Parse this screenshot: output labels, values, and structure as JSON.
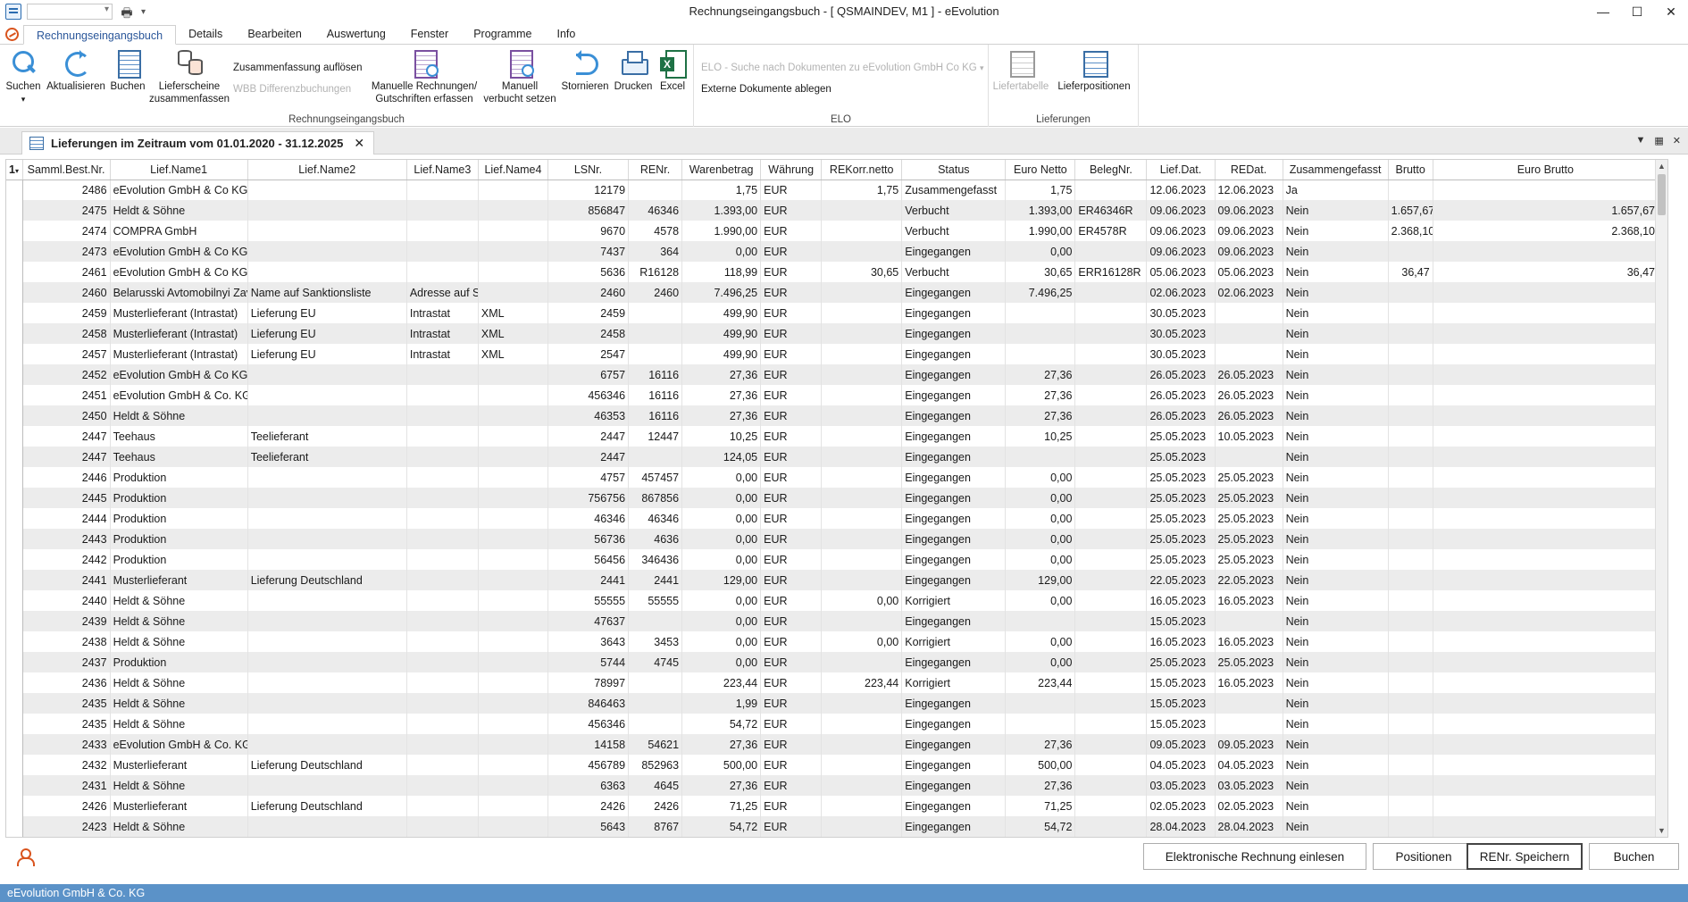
{
  "window": {
    "title": "Rechnungseingangsbuch - [ QSMAINDEV, M1 ]  -  eEvolution",
    "controls": [
      "—",
      "☐",
      "✕"
    ]
  },
  "ribbon_tabs": [
    "Rechnungseingangsbuch",
    "Details",
    "Bearbeiten",
    "Auswertung",
    "Fenster",
    "Programme",
    "Info"
  ],
  "ribbon": {
    "suchen": "Suchen",
    "aktualisieren": "Aktualisieren",
    "buchen": "Buchen",
    "lieferscheine_1": "Lieferscheine",
    "lieferscheine_2": "zusammenfassen",
    "zusammenfassung": "Zusammenfassung  auflösen",
    "wbb": "WBB Differenzbuchungen",
    "manuelle_1": "Manuelle Rechnungen/",
    "manuelle_2": "Gutschriften erfassen",
    "manuell_1": "Manuell",
    "manuell_2": "verbucht setzen",
    "stornieren": "Stornieren",
    "drucken": "Drucken",
    "excel": "Excel",
    "group_reb": "Rechnungseingangsbuch",
    "elo_search": "ELO - Suche nach Dokumenten zu eEvolution GmbH  Co KG",
    "elo_extern": "Externe Dokumente ablegen",
    "group_elo": "ELO",
    "liefertabelle": "Liefertabelle",
    "lieferpositionen": "Lieferpositionen",
    "group_lief": "Lieferungen"
  },
  "doc_tab": {
    "label": "Lieferungen im Zeitraum vom 01.01.2020 - 31.12.2025",
    "close": "✕"
  },
  "grid": {
    "selector_header": "1",
    "columns": [
      "Samml.Best.Nr.",
      "Lief.Name1",
      "Lief.Name2",
      "Lief.Name3",
      "Lief.Name4",
      "LSNr.",
      "RENr.",
      "Warenbetrag",
      "Währung",
      "REKorr.netto",
      "Status",
      "Euro Netto",
      "BelegNr.",
      "Lief.Dat.",
      "REDat.",
      "Zusammengefasst",
      "Brutto",
      "Euro Brutto"
    ],
    "rows": [
      [
        "2486",
        "eEvolution GmbH & Co KG",
        "",
        "",
        "",
        "12179",
        "",
        "1,75",
        "EUR",
        "1,75",
        "Zusammengefasst",
        "1,75",
        "",
        "12.06.2023",
        "12.06.2023",
        "Ja",
        "",
        ""
      ],
      [
        "2475",
        "Heldt & Söhne",
        "",
        "",
        "",
        "856847",
        "46346",
        "1.393,00",
        "EUR",
        "",
        "Verbucht",
        "1.393,00",
        "ER46346R",
        "09.06.2023",
        "09.06.2023",
        "Nein",
        "1.657,67",
        "1.657,67"
      ],
      [
        "2474",
        "COMPRA GmbH",
        "",
        "",
        "",
        "9670",
        "4578",
        "1.990,00",
        "EUR",
        "",
        "Verbucht",
        "1.990,00",
        "ER4578R",
        "09.06.2023",
        "09.06.2023",
        "Nein",
        "2.368,10",
        "2.368,10"
      ],
      [
        "2473",
        "eEvolution GmbH & Co KG",
        "",
        "",
        "",
        "7437",
        "364",
        "0,00",
        "EUR",
        "",
        "Eingegangen",
        "0,00",
        "",
        "09.06.2023",
        "09.06.2023",
        "Nein",
        "",
        ""
      ],
      [
        "2461",
        "eEvolution GmbH & Co KG",
        "",
        "",
        "",
        "5636",
        "R16128",
        "118,99",
        "EUR",
        "30,65",
        "Verbucht",
        "30,65",
        "ERR16128R",
        "05.06.2023",
        "05.06.2023",
        "Nein",
        "36,47",
        "36,47"
      ],
      [
        "2460",
        "Belarusski  Avtomobilnyi Zavod",
        "Name auf Sanktionsliste",
        "Adresse auf Sanktionsliste",
        "",
        "2460",
        "2460",
        "7.496,25",
        "EUR",
        "",
        "Eingegangen",
        "7.496,25",
        "",
        "02.06.2023",
        "02.06.2023",
        "Nein",
        "",
        ""
      ],
      [
        "2459",
        "Musterlieferant (Intrastat)",
        "Lieferung EU",
        "Intrastat",
        "XML",
        "2459",
        "",
        "499,90",
        "EUR",
        "",
        "Eingegangen",
        "",
        "",
        "30.05.2023",
        "",
        "Nein",
        "",
        ""
      ],
      [
        "2458",
        "Musterlieferant (Intrastat)",
        "Lieferung EU",
        "Intrastat",
        "XML",
        "2458",
        "",
        "499,90",
        "EUR",
        "",
        "Eingegangen",
        "",
        "",
        "30.05.2023",
        "",
        "Nein",
        "",
        ""
      ],
      [
        "2457",
        "Musterlieferant (Intrastat)",
        "Lieferung EU",
        "Intrastat",
        "XML",
        "2547",
        "",
        "499,90",
        "EUR",
        "",
        "Eingegangen",
        "",
        "",
        "30.05.2023",
        "",
        "Nein",
        "",
        ""
      ],
      [
        "2452",
        "eEvolution GmbH & Co KG",
        "",
        "",
        "",
        "6757",
        "16116",
        "27,36",
        "EUR",
        "",
        "Eingegangen",
        "27,36",
        "",
        "26.05.2023",
        "26.05.2023",
        "Nein",
        "",
        ""
      ],
      [
        "2451",
        "eEvolution GmbH & Co. KG",
        "",
        "",
        "",
        "456346",
        "16116",
        "27,36",
        "EUR",
        "",
        "Eingegangen",
        "27,36",
        "",
        "26.05.2023",
        "26.05.2023",
        "Nein",
        "",
        ""
      ],
      [
        "2450",
        "Heldt & Söhne",
        "",
        "",
        "",
        "46353",
        "16116",
        "27,36",
        "EUR",
        "",
        "Eingegangen",
        "27,36",
        "",
        "26.05.2023",
        "26.05.2023",
        "Nein",
        "",
        ""
      ],
      [
        "2447",
        "Teehaus",
        "Teelieferant",
        "",
        "",
        "2447",
        "12447",
        "10,25",
        "EUR",
        "",
        "Eingegangen",
        "10,25",
        "",
        "25.05.2023",
        "10.05.2023",
        "Nein",
        "",
        ""
      ],
      [
        "2447",
        "Teehaus",
        "Teelieferant",
        "",
        "",
        "2447",
        "",
        "124,05",
        "EUR",
        "",
        "Eingegangen",
        "",
        "",
        "25.05.2023",
        "",
        "Nein",
        "",
        ""
      ],
      [
        "2446",
        "Produktion",
        "",
        "",
        "",
        "4757",
        "457457",
        "0,00",
        "EUR",
        "",
        "Eingegangen",
        "0,00",
        "",
        "25.05.2023",
        "25.05.2023",
        "Nein",
        "",
        ""
      ],
      [
        "2445",
        "Produktion",
        "",
        "",
        "",
        "756756",
        "867856",
        "0,00",
        "EUR",
        "",
        "Eingegangen",
        "0,00",
        "",
        "25.05.2023",
        "25.05.2023",
        "Nein",
        "",
        ""
      ],
      [
        "2444",
        "Produktion",
        "",
        "",
        "",
        "46346",
        "46346",
        "0,00",
        "EUR",
        "",
        "Eingegangen",
        "0,00",
        "",
        "25.05.2023",
        "25.05.2023",
        "Nein",
        "",
        ""
      ],
      [
        "2443",
        "Produktion",
        "",
        "",
        "",
        "56736",
        "4636",
        "0,00",
        "EUR",
        "",
        "Eingegangen",
        "0,00",
        "",
        "25.05.2023",
        "25.05.2023",
        "Nein",
        "",
        ""
      ],
      [
        "2442",
        "Produktion",
        "",
        "",
        "",
        "56456",
        "346436",
        "0,00",
        "EUR",
        "",
        "Eingegangen",
        "0,00",
        "",
        "25.05.2023",
        "25.05.2023",
        "Nein",
        "",
        ""
      ],
      [
        "2441",
        "Musterlieferant",
        "Lieferung Deutschland",
        "",
        "",
        "2441",
        "2441",
        "129,00",
        "EUR",
        "",
        "Eingegangen",
        "129,00",
        "",
        "22.05.2023",
        "22.05.2023",
        "Nein",
        "",
        ""
      ],
      [
        "2440",
        "Heldt & Söhne",
        "",
        "",
        "",
        "55555",
        "55555",
        "0,00",
        "EUR",
        "0,00",
        "Korrigiert",
        "0,00",
        "",
        "16.05.2023",
        "16.05.2023",
        "Nein",
        "",
        ""
      ],
      [
        "2439",
        "Heldt & Söhne",
        "",
        "",
        "",
        "47637",
        "",
        "0,00",
        "EUR",
        "",
        "Eingegangen",
        "",
        "",
        "15.05.2023",
        "",
        "Nein",
        "",
        ""
      ],
      [
        "2438",
        "Heldt & Söhne",
        "",
        "",
        "",
        "3643",
        "3453",
        "0,00",
        "EUR",
        "0,00",
        "Korrigiert",
        "0,00",
        "",
        "16.05.2023",
        "16.05.2023",
        "Nein",
        "",
        ""
      ],
      [
        "2437",
        "Produktion",
        "",
        "",
        "",
        "5744",
        "4745",
        "0,00",
        "EUR",
        "",
        "Eingegangen",
        "0,00",
        "",
        "25.05.2023",
        "25.05.2023",
        "Nein",
        "",
        ""
      ],
      [
        "2436",
        "Heldt & Söhne",
        "",
        "",
        "",
        "78997",
        "",
        "223,44",
        "EUR",
        "223,44",
        "Korrigiert",
        "223,44",
        "",
        "15.05.2023",
        "16.05.2023",
        "Nein",
        "",
        ""
      ],
      [
        "2435",
        "Heldt & Söhne",
        "",
        "",
        "",
        "846463",
        "",
        "1,99",
        "EUR",
        "",
        "Eingegangen",
        "",
        "",
        "15.05.2023",
        "",
        "Nein",
        "",
        ""
      ],
      [
        "2435",
        "Heldt & Söhne",
        "",
        "",
        "",
        "456346",
        "",
        "54,72",
        "EUR",
        "",
        "Eingegangen",
        "",
        "",
        "15.05.2023",
        "",
        "Nein",
        "",
        ""
      ],
      [
        "2433",
        "eEvolution GmbH & Co. KG",
        "",
        "",
        "",
        "14158",
        "54621",
        "27,36",
        "EUR",
        "",
        "Eingegangen",
        "27,36",
        "",
        "09.05.2023",
        "09.05.2023",
        "Nein",
        "",
        ""
      ],
      [
        "2432",
        "Musterlieferant",
        "Lieferung Deutschland",
        "",
        "",
        "456789",
        "852963",
        "500,00",
        "EUR",
        "",
        "Eingegangen",
        "500,00",
        "",
        "04.05.2023",
        "04.05.2023",
        "Nein",
        "",
        ""
      ],
      [
        "2431",
        "Heldt & Söhne",
        "",
        "",
        "",
        "6363",
        "4645",
        "27,36",
        "EUR",
        "",
        "Eingegangen",
        "27,36",
        "",
        "03.05.2023",
        "03.05.2023",
        "Nein",
        "",
        ""
      ],
      [
        "2426",
        "Musterlieferant",
        "Lieferung Deutschland",
        "",
        "",
        "2426",
        "2426",
        "71,25",
        "EUR",
        "",
        "Eingegangen",
        "71,25",
        "",
        "02.05.2023",
        "02.05.2023",
        "Nein",
        "",
        ""
      ],
      [
        "2423",
        "Heldt & Söhne",
        "",
        "",
        "",
        "5643",
        "8767",
        "54,72",
        "EUR",
        "",
        "Eingegangen",
        "54,72",
        "",
        "28.04.2023",
        "28.04.2023",
        "Nein",
        "",
        ""
      ]
    ]
  },
  "bottom_buttons": {
    "elektronische": "Elektronische Rechnung einlesen",
    "positionen": "Positionen",
    "renr": "RENr. Speichern",
    "buchen": "Buchen"
  },
  "status_bar": "eEvolution GmbH & Co. KG"
}
